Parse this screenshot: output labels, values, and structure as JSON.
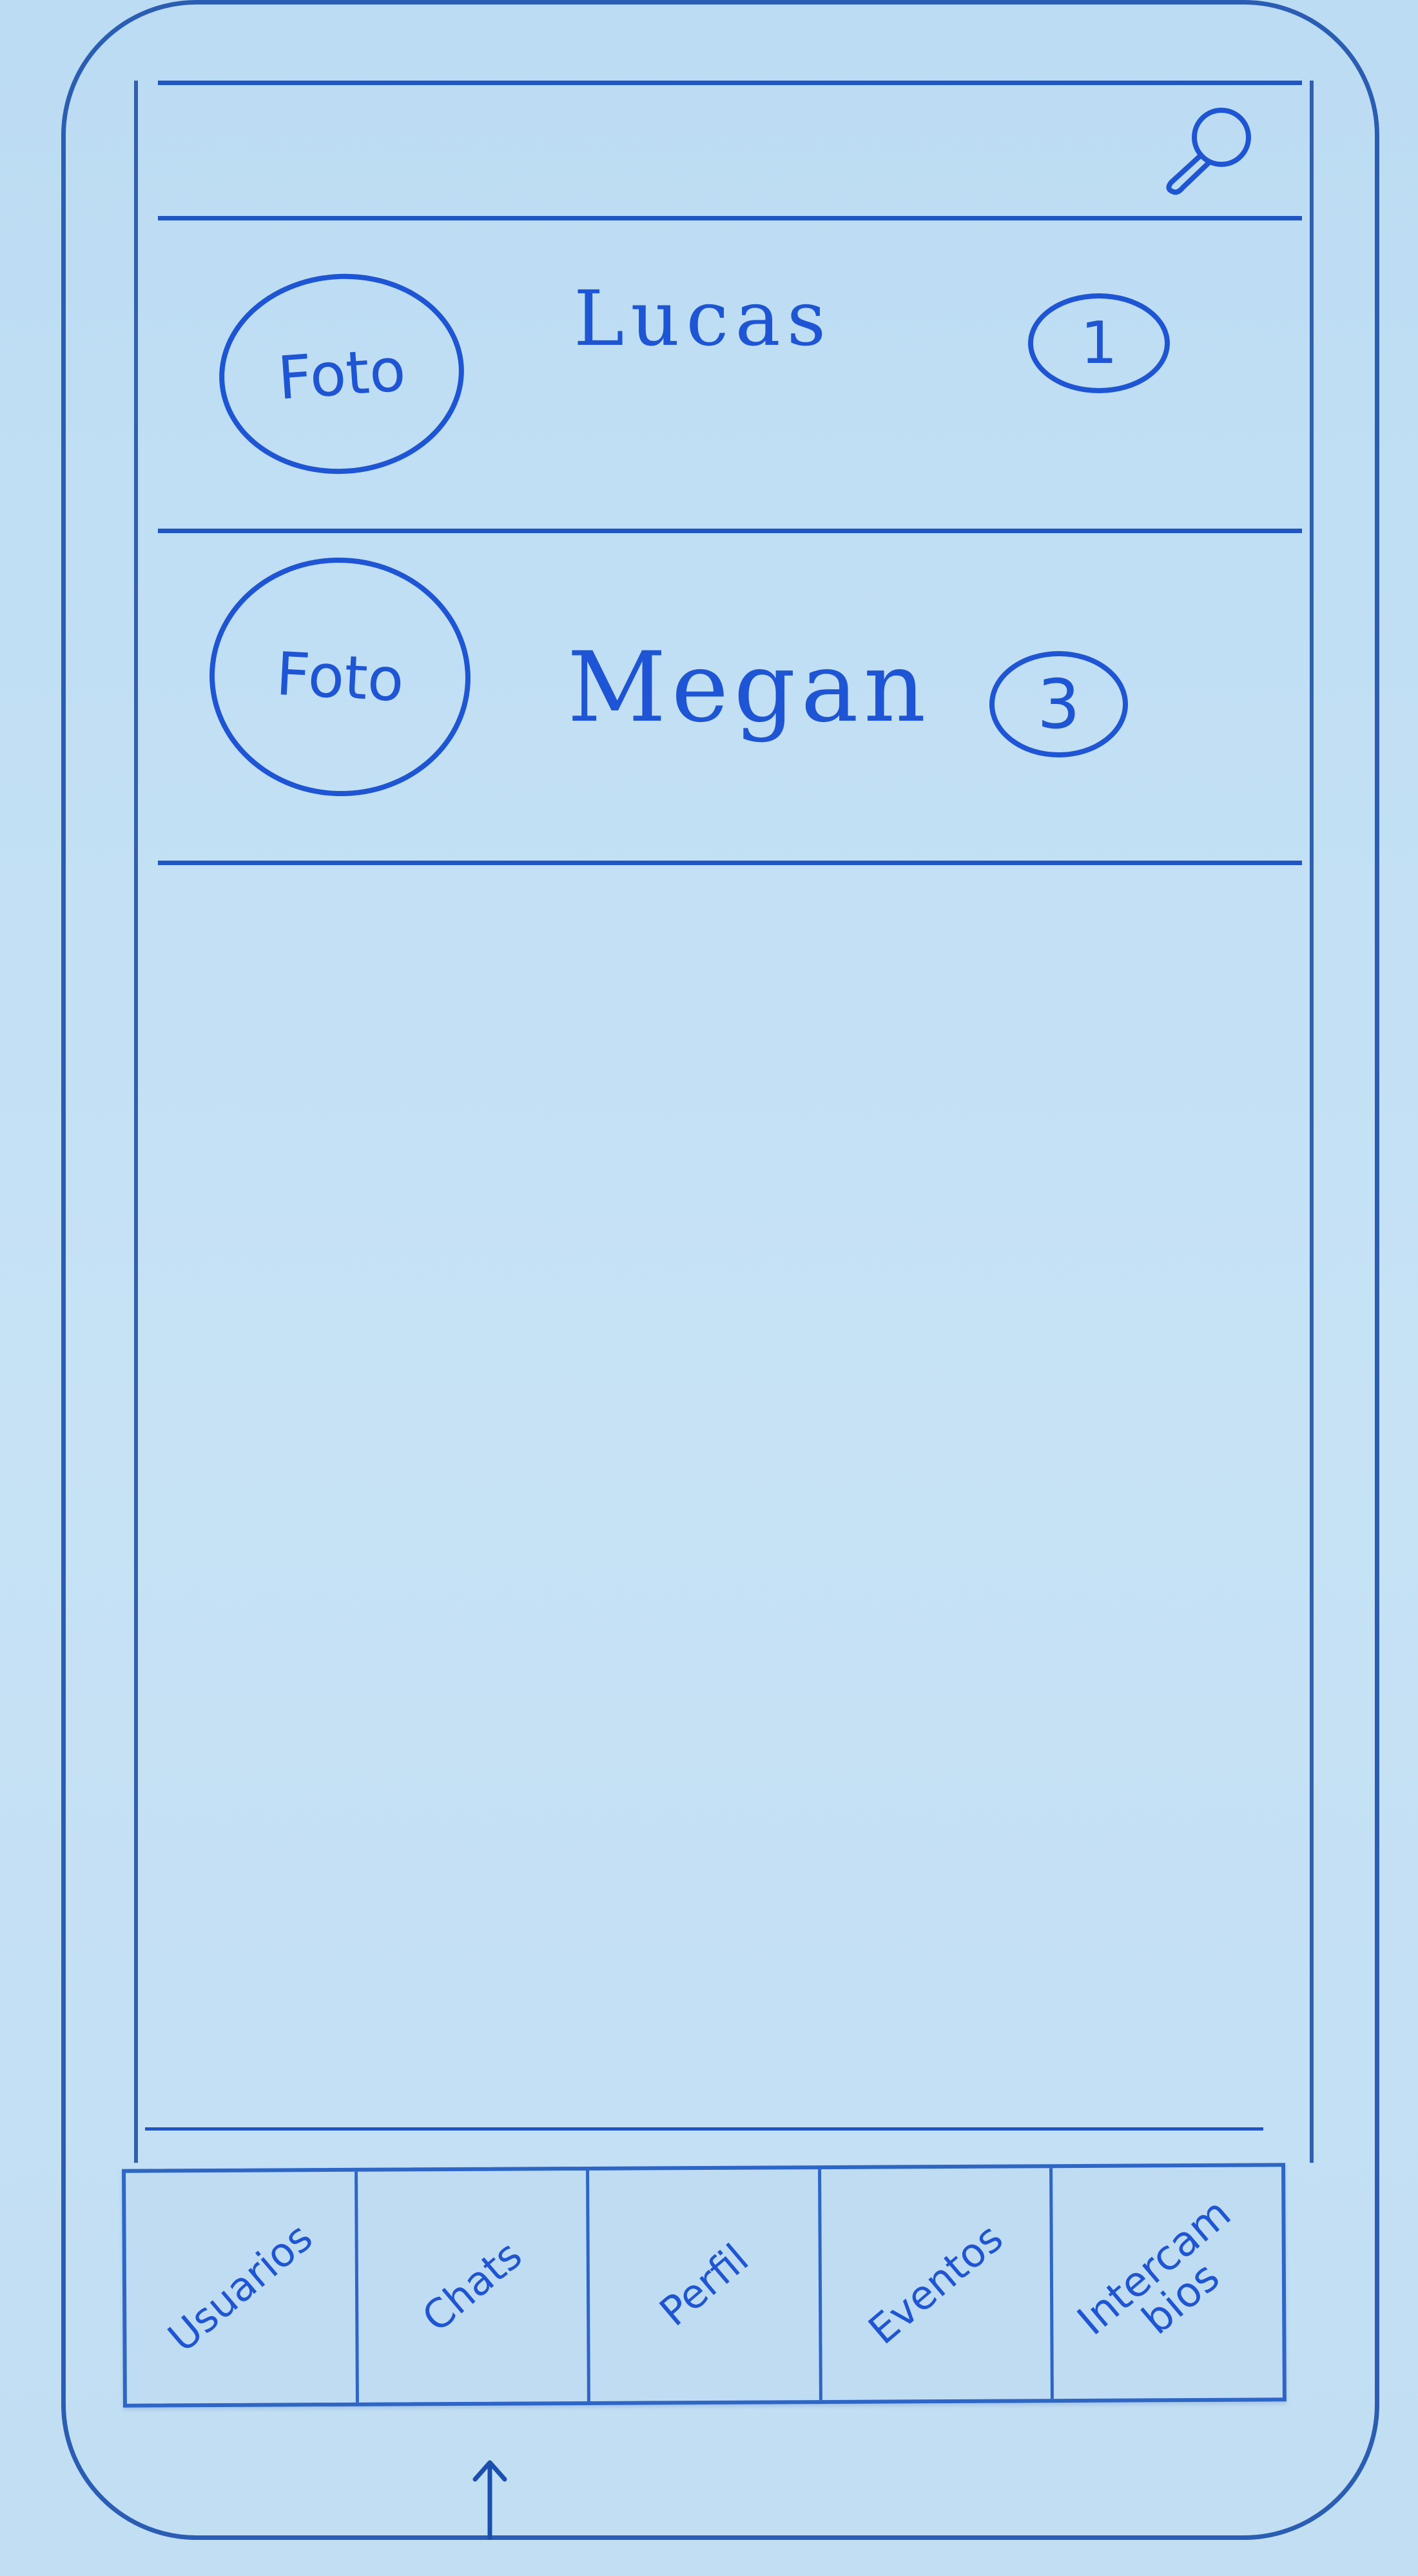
{
  "search": {
    "icon": "search-icon"
  },
  "chats": [
    {
      "avatar_label": "Foto",
      "name": "Lucas",
      "unread": "1"
    },
    {
      "avatar_label": "Foto",
      "name": "Megan",
      "unread": "3"
    }
  ],
  "tab_bar": {
    "tabs": [
      {
        "label": "Usuarios"
      },
      {
        "label": "Chats"
      },
      {
        "label": "Perfil"
      },
      {
        "label": "Eventos"
      },
      {
        "label": "Intercam\nbios"
      }
    ],
    "active_indicator_icon": "up-arrow-icon"
  },
  "colors": {
    "ink": "#1e55d6",
    "paper": "#c4dff2"
  }
}
